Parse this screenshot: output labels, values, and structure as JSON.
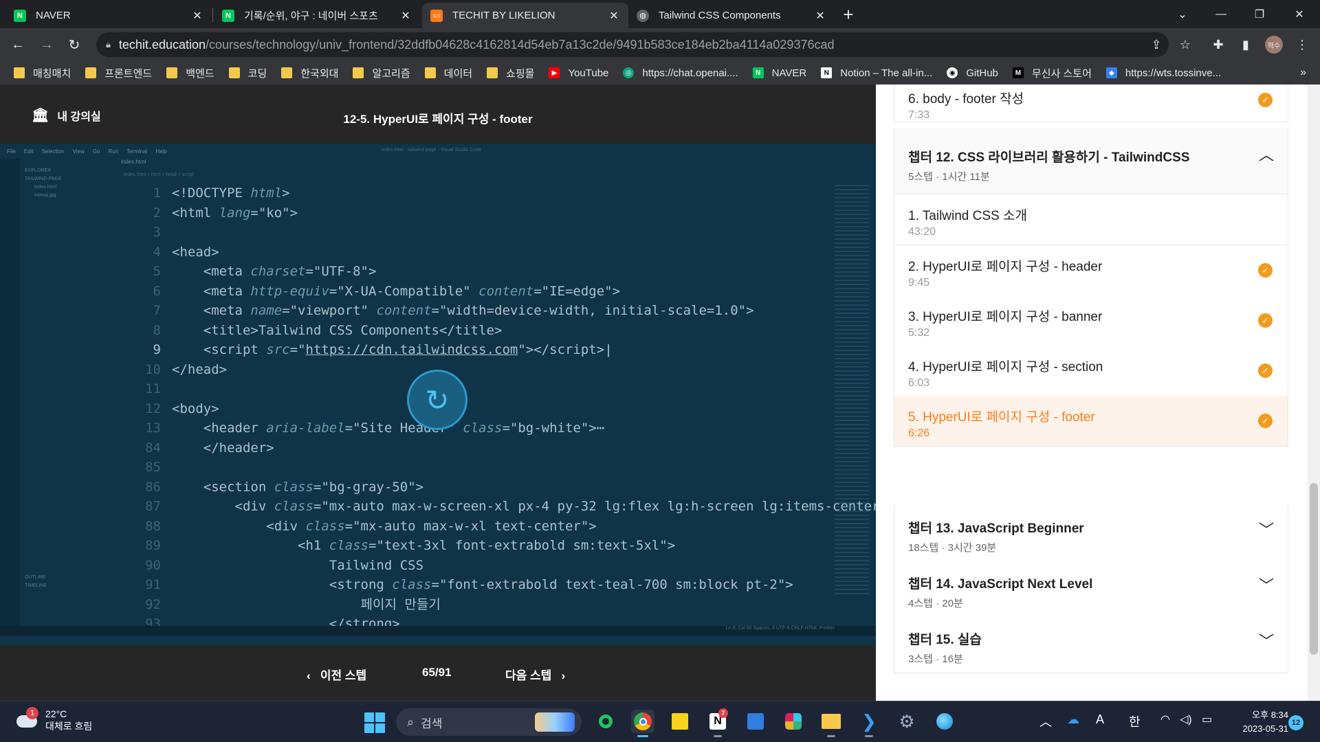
{
  "browser": {
    "tabs": [
      {
        "title": "NAVER",
        "favicon": "N",
        "color": "#03c75a"
      },
      {
        "title": "기록/순위, 야구 : 네이버 스포츠",
        "favicon": "N",
        "color": "#03c75a"
      },
      {
        "title": "TECHIT BY LIKELION",
        "favicon": "◘",
        "color": "#ff7a1a"
      },
      {
        "title": "Tailwind CSS Components",
        "favicon": "◍",
        "color": "#5f6368"
      }
    ],
    "url_host": "techit.education",
    "url_path": "/courses/technology/univ_frontend/32ddfb04628c4162814d54eb7a13c2de/9491b583ce184eb2ba4114a029376cad",
    "avatar_text": "혁수",
    "bookmarks": [
      {
        "label": "매칭매치",
        "type": "folder"
      },
      {
        "label": "프론트엔드",
        "type": "folder"
      },
      {
        "label": "백엔드",
        "type": "folder"
      },
      {
        "label": "코딩",
        "type": "folder"
      },
      {
        "label": "한국외대",
        "type": "folder"
      },
      {
        "label": "알고리즘",
        "type": "folder"
      },
      {
        "label": "데이터",
        "type": "folder"
      },
      {
        "label": "쇼핑몰",
        "type": "folder"
      },
      {
        "label": "YouTube",
        "type": "youtube"
      },
      {
        "label": "https://chat.openai....",
        "type": "openai"
      },
      {
        "label": "NAVER",
        "type": "naver"
      },
      {
        "label": "Notion – The all-in...",
        "type": "notion"
      },
      {
        "label": "GitHub",
        "type": "github"
      },
      {
        "label": "무신사 스토어",
        "type": "musinsa"
      },
      {
        "label": "https://wts.tossinve...",
        "type": "toss"
      }
    ],
    "bookmarks_more": "»"
  },
  "player": {
    "my_classroom": "내 강의실",
    "lecture_title": "12-5. HyperUI로 페이지 구성 - footer",
    "prev_label": "이전 스텝",
    "next_label": "다음 스텝",
    "counter": "65/91"
  },
  "code_lines": [
    {
      "n": "1",
      "html": "&lt;!DOCTYPE <span class='at'>html</span>&gt;"
    },
    {
      "n": "2",
      "html": "&lt;html <span class='at'>lang</span>=\"ko\"&gt;"
    },
    {
      "n": "3",
      "html": ""
    },
    {
      "n": "4",
      "html": "&lt;head&gt;"
    },
    {
      "n": "5",
      "html": "    &lt;meta <span class='at'>charset</span>=\"UTF-8\"&gt;"
    },
    {
      "n": "6",
      "html": "    &lt;meta <span class='at'>http-equiv</span>=\"X-UA-Compatible\" <span class='at'>content</span>=\"IE=edge\"&gt;"
    },
    {
      "n": "7",
      "html": "    &lt;meta <span class='at'>name</span>=\"viewport\" <span class='at'>content</span>=\"width=device-width, initial-scale=1.0\"&gt;"
    },
    {
      "n": "8",
      "html": "    &lt;title&gt;Tailwind CSS Components&lt;/title&gt;"
    },
    {
      "n": "9",
      "html": "    &lt;script <span class='at'>src</span>=\"<u>https://cdn.tailwindcss.com</u>\"&gt;&lt;/script&gt;|",
      "cur": true
    },
    {
      "n": "10",
      "html": "&lt;/head&gt;"
    },
    {
      "n": "11",
      "html": ""
    },
    {
      "n": "12",
      "html": "&lt;body&gt;"
    },
    {
      "n": "13",
      "html": "    &lt;header <span class='at'>aria-label</span>=\"Site Header\" <span class='at'>class</span>=\"bg-white\"&gt;⋯"
    },
    {
      "n": "84",
      "html": "    &lt;/header&gt;"
    },
    {
      "n": "85",
      "html": ""
    },
    {
      "n": "86",
      "html": "    &lt;section <span class='at'>class</span>=\"bg-gray-50\"&gt;"
    },
    {
      "n": "87",
      "html": "        &lt;div <span class='at'>class</span>=\"mx-auto max-w-screen-xl px-4 py-32 lg:flex lg:h-screen lg:items-center"
    },
    {
      "n": "88",
      "html": "            &lt;div <span class='at'>class</span>=\"mx-auto max-w-xl text-center\"&gt;"
    },
    {
      "n": "89",
      "html": "                &lt;h1 <span class='at'>class</span>=\"text-3xl font-extrabold sm:text-5xl\"&gt;"
    },
    {
      "n": "90",
      "html": "                    Tailwind CSS"
    },
    {
      "n": "91",
      "html": "                    &lt;strong <span class='at'>class</span>=\"font-extrabold text-teal-700 sm:block pt-2\"&gt;"
    },
    {
      "n": "92",
      "html": "                        페이지 만들기"
    },
    {
      "n": "93",
      "html": "                    &lt;/strong&gt;"
    }
  ],
  "vscode": {
    "menu": [
      "File",
      "Edit",
      "Selection",
      "View",
      "Go",
      "Run",
      "Terminal",
      "Help"
    ],
    "window_title": "index.html - tailwind-page - Visual Studio Code",
    "explorer_title": "EXPLORER",
    "folder": "TAILWIND-PAGE",
    "files": [
      "index.html",
      "mimoji.jpg"
    ],
    "tab": "index.html",
    "breadcrumb": "index.html > html > head > script",
    "outline": "OUTLINE",
    "timeline": "TIMELINE",
    "status": "Ln 9, Col 56   Spaces: 4   UTF-8   CRLF   HTML   Prettier"
  },
  "curriculum": {
    "top_partial": {
      "title": "6. body - footer 작성",
      "time": "7:33",
      "done": true
    },
    "chapter12": {
      "title": "챕터 12. CSS 라이브러리 활용하기 - TailwindCSS",
      "meta": "5스텝 · 1시간 11분",
      "chev": "︿"
    },
    "steps": [
      {
        "title": "1. Tailwind CSS 소개",
        "time": "43:20",
        "done": false
      },
      {
        "title": "2. HyperUI로 페이지 구성 - header",
        "time": "9:45",
        "done": true
      },
      {
        "title": "3. HyperUI로 페이지 구성 - banner",
        "time": "5:32",
        "done": true
      },
      {
        "title": "4. HyperUI로 페이지 구성 - section",
        "time": "6:03",
        "done": true
      },
      {
        "title": "5. HyperUI로 페이지 구성 - footer",
        "time": "6:26",
        "done": true
      }
    ],
    "chapters": [
      {
        "title": "챕터 13. JavaScript Beginner",
        "meta": "18스텝 · 3시간 39분"
      },
      {
        "title": "챕터 14. JavaScript Next Level",
        "meta": "4스텝 · 20분"
      },
      {
        "title": "챕터 15. 실습",
        "meta": "3스텝 · 16분"
      }
    ]
  },
  "taskbar": {
    "weather_temp": "22°C",
    "weather_desc": "대체로 흐림",
    "weather_badge": "1",
    "search_label": "검색",
    "notion_badge": "7",
    "tray_lang1": "A",
    "tray_lang2": "한",
    "clock_time": "오후 8:34",
    "clock_date": "2023-05-31",
    "notif_count": "12"
  }
}
